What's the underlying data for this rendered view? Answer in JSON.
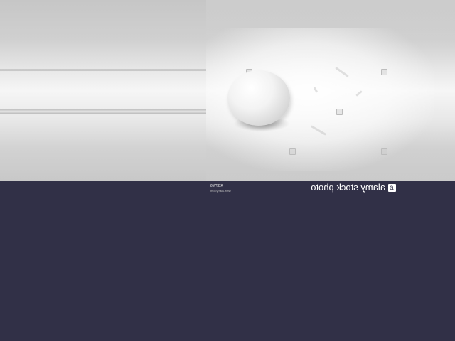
{
  "photo": {
    "subject": "white egg",
    "watermark_icon": "alamy-logo-icon"
  },
  "banner": {
    "brand_text": "alamy stock photo",
    "logo_letter": "a",
    "image_id": "RG7W6",
    "url": "www.alamy.com",
    "background_color": "#313047"
  }
}
